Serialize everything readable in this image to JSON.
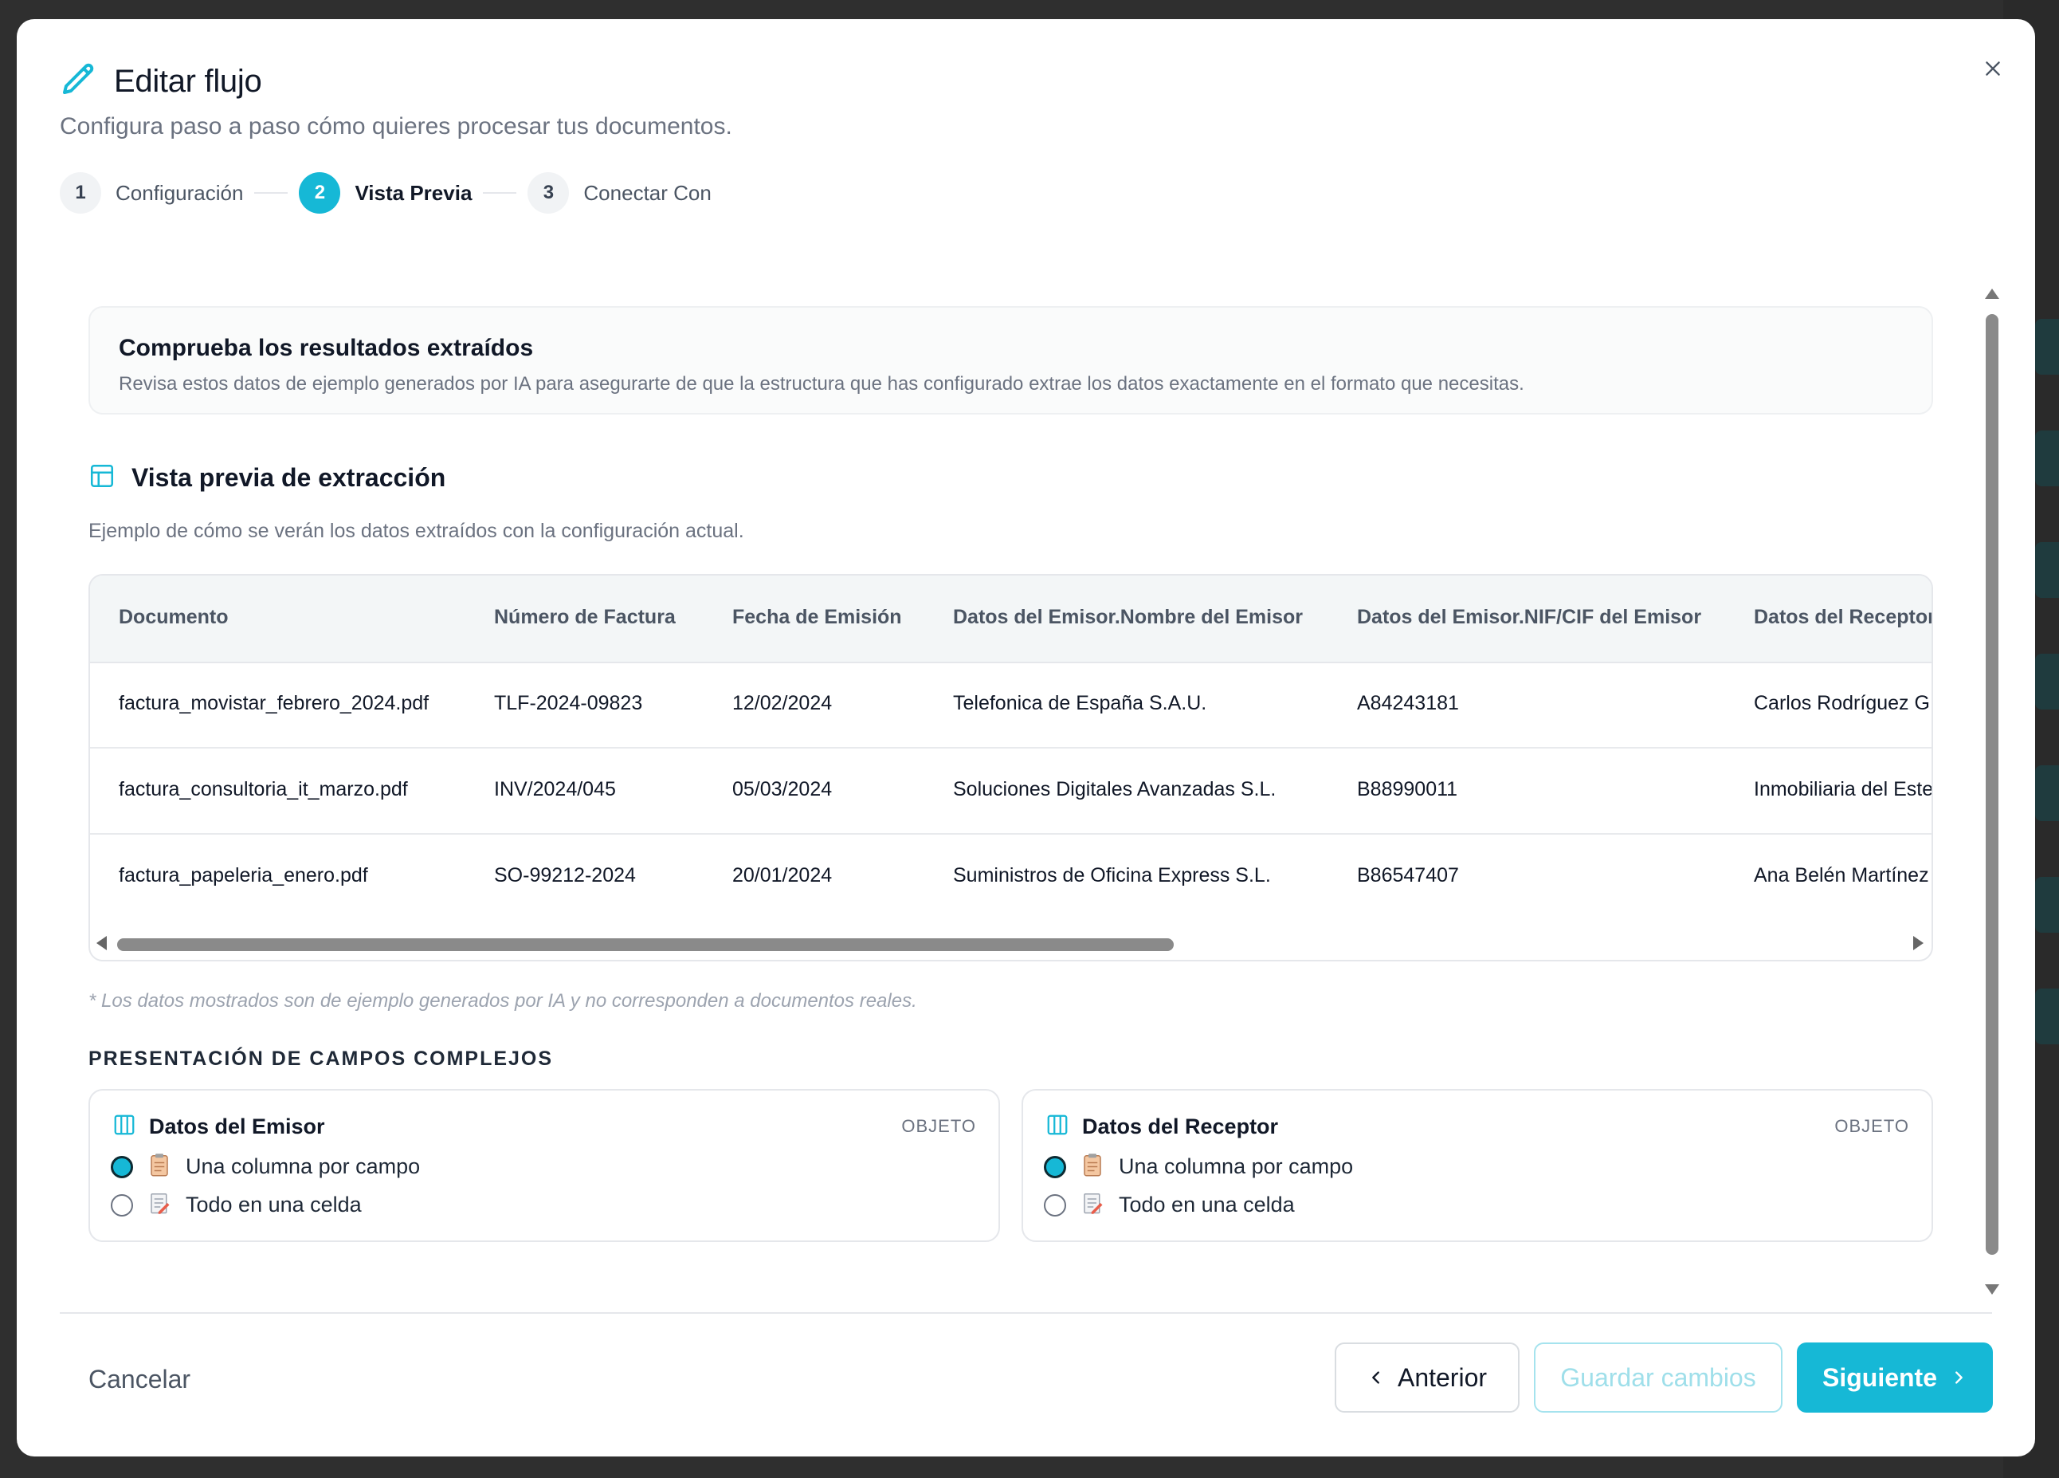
{
  "header": {
    "title": "Editar flujo",
    "subtitle": "Configura paso a paso cómo quieres procesar tus documentos."
  },
  "stepper": [
    {
      "num": "1",
      "label": "Configuración",
      "active": false
    },
    {
      "num": "2",
      "label": "Vista Previa",
      "active": true
    },
    {
      "num": "3",
      "label": "Conectar Con",
      "active": false
    }
  ],
  "info": {
    "title": "Comprueba los resultados extraídos",
    "description": "Revisa estos datos de ejemplo generados por IA para asegurarte de que la estructura que has configurado extrae los datos exactamente en el formato que necesitas."
  },
  "preview": {
    "title": "Vista previa de extracción",
    "description": "Ejemplo de cómo se verán los datos extraídos con la configuración actual.",
    "columns": [
      "Documento",
      "Número de Factura",
      "Fecha de Emisión",
      "Datos del Emisor.Nombre del Emisor",
      "Datos del Emisor.NIF/CIF del Emisor",
      "Datos del Receptor"
    ],
    "rows": [
      [
        "factura_movistar_febrero_2024.pdf",
        "TLF-2024-09823",
        "12/02/2024",
        "Telefonica de España S.A.U.",
        "A84243181",
        "Carlos Rodríguez G"
      ],
      [
        "factura_consultoria_it_marzo.pdf",
        "INV/2024/045",
        "05/03/2024",
        "Soluciones Digitales Avanzadas S.L.",
        "B88990011",
        "Inmobiliaria del Este"
      ],
      [
        "factura_papeleria_enero.pdf",
        "SO-99212-2024",
        "20/01/2024",
        "Suministros de Oficina Express S.L.",
        "B86547407",
        "Ana Belén Martínez"
      ]
    ],
    "footnote": "* Los datos mostrados son de ejemplo generados por IA y no corresponden a documentos reales."
  },
  "complex": {
    "title": "PRESENTACIÓN DE CAMPOS COMPLEJOS",
    "fields": [
      {
        "name": "Datos del Emisor",
        "type": "OBJETO",
        "options": [
          "Una columna por campo",
          "Todo en una celda"
        ],
        "selected": 0
      },
      {
        "name": "Datos del Receptor",
        "type": "OBJETO",
        "options": [
          "Una columna por campo",
          "Todo en una celda"
        ],
        "selected": 0
      }
    ]
  },
  "footer": {
    "cancel": "Cancelar",
    "prev": "Anterior",
    "save": "Guardar cambios",
    "next": "Siguiente"
  },
  "colors": {
    "accent": "#16b8d6",
    "accent_light": "#a5e3ee"
  },
  "icons": [
    "pencil-icon",
    "close-icon",
    "table-icon",
    "columns-icon",
    "clipboard-icon",
    "memo-icon",
    "chevron-left-icon",
    "chevron-right-icon"
  ]
}
